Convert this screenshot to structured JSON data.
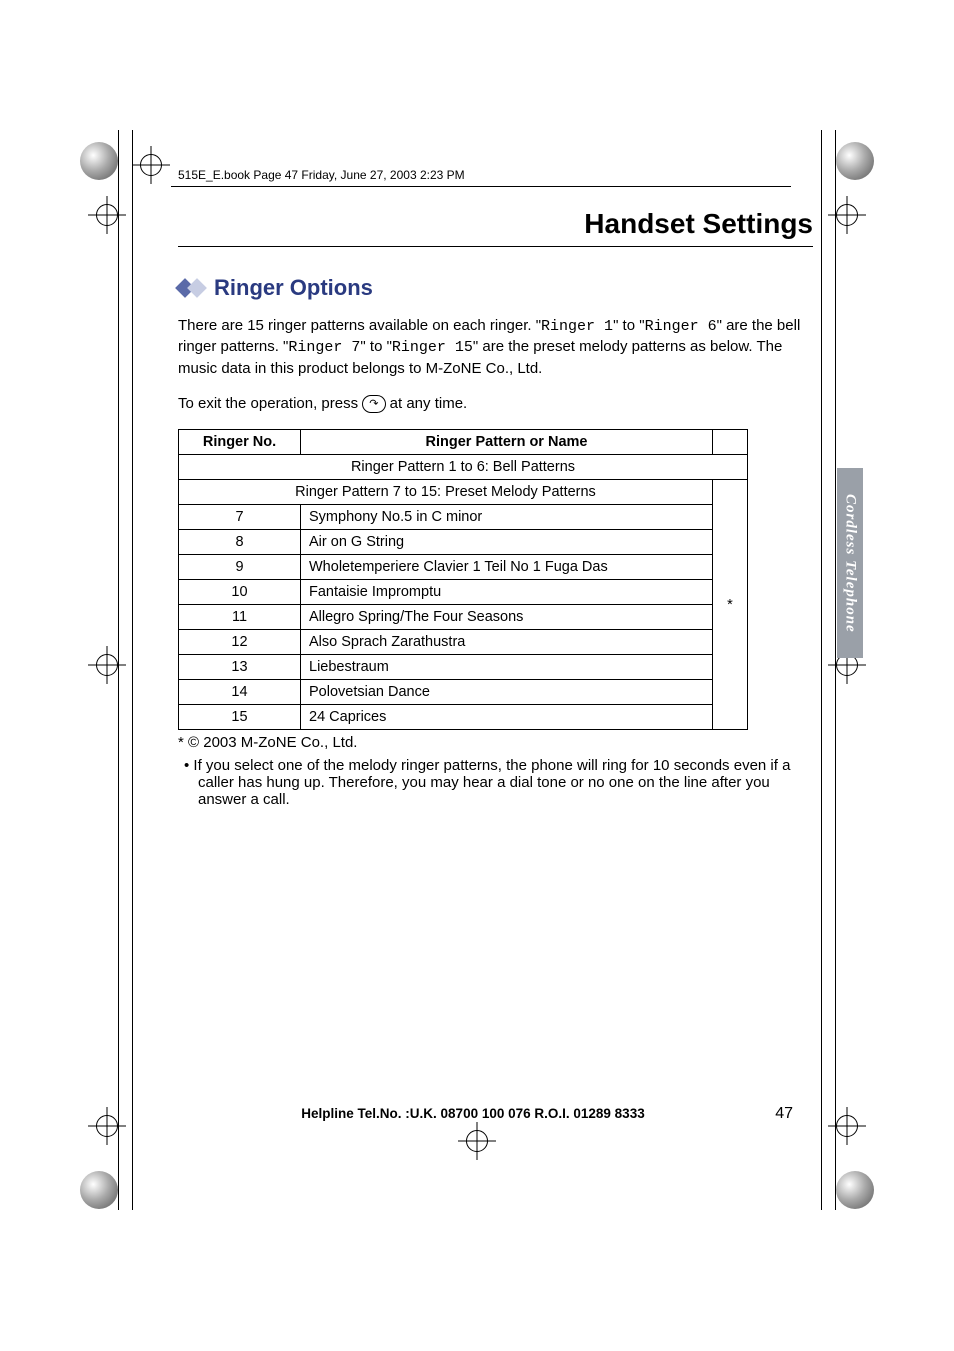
{
  "running_head": "515E_E.book  Page 47  Friday, June 27, 2003  2:23 PM",
  "chapter_title": "Handset Settings",
  "section_title": "Ringer Options",
  "side_tab": "Cordless Telephone",
  "intro": {
    "p1a": "There are 15 ringer patterns available on each ringer. \"",
    "p1_code1": "Ringer 1",
    "p1b": "\" to \"",
    "p1_code2": "Ringer 6",
    "p1c": "\" are the bell ringer patterns. \"",
    "p1_code3": "Ringer 7",
    "p1d": "\" to \"",
    "p1_code4": "Ringer 15",
    "p1e": "\" are the preset melody patterns as below. The music data in this product belongs to M-ZoNE Co., Ltd.",
    "p2a": "To exit the operation, press ",
    "p2_key": "↷",
    "p2b": " at any time."
  },
  "table": {
    "h1": "Ringer No.",
    "h2": "Ringer Pattern or Name",
    "span1": "Ringer Pattern 1 to 6: Bell Patterns",
    "span2": "Ringer Pattern 7 to 15: Preset Melody Patterns",
    "star": "*",
    "rows": [
      {
        "no": "7",
        "name": "Symphony No.5 in C minor"
      },
      {
        "no": "8",
        "name": "Air on G String"
      },
      {
        "no": "9",
        "name": "Wholetemperiere Clavier 1 Teil No 1 Fuga Das"
      },
      {
        "no": "10",
        "name": "Fantaisie Impromptu"
      },
      {
        "no": "11",
        "name": "Allegro Spring/The Four Seasons"
      },
      {
        "no": "12",
        "name": "Also Sprach Zarathustra"
      },
      {
        "no": "13",
        "name": "Liebestraum"
      },
      {
        "no": "14",
        "name": "Polovetsian Dance"
      },
      {
        "no": "15",
        "name": "24 Caprices"
      }
    ]
  },
  "footnote": "* © 2003 M-ZoNE Co., Ltd.",
  "bullet_note": "• If you select one of the melody ringer patterns, the phone will ring for 10 seconds even if a caller has hung up. Therefore, you may hear a dial tone or no one on the line after you answer a call.",
  "footer_help": "Helpline Tel.No. :U.K. 08700 100 076  R.O.I. 01289 8333",
  "page_number": "47"
}
